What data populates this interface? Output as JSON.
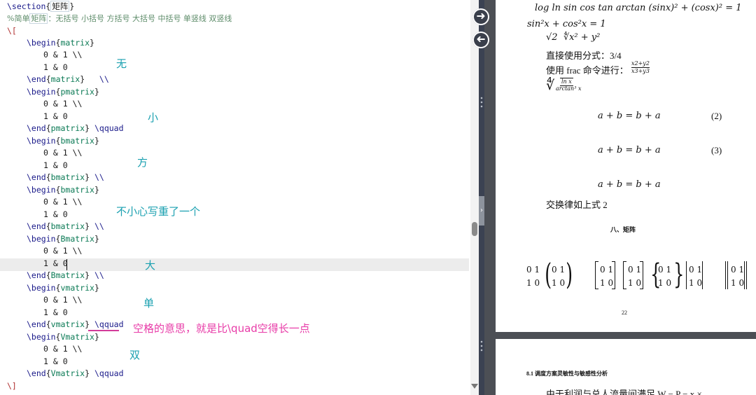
{
  "editor": {
    "lines": {
      "section": [
        "\\section",
        "{",
        "矩阵",
        "}"
      ],
      "comment": [
        "%简单",
        "矩阵",
        "：无括号 小括号 方括号 大括号 中括号 单竖线 双竖线"
      ],
      "open": "\\[",
      "close": "\\]",
      "matrix_begin": [
        "\\begin",
        "{",
        "matrix",
        "}"
      ],
      "row1": "0 & 1 \\\\",
      "row2": "1 & 0",
      "matrix_end": [
        "\\end",
        "{",
        "matrix",
        "}",
        "   \\\\"
      ],
      "pmatrix_begin": [
        "\\begin",
        "{",
        "pmatrix",
        "}"
      ],
      "pmatrix_end": [
        "\\end",
        "{",
        "pmatrix",
        "}",
        " \\qquad"
      ],
      "bmatrix_begin": [
        "\\begin",
        "{",
        "bmatrix",
        "}"
      ],
      "bmatrix_end": [
        "\\end",
        "{",
        "bmatrix",
        "}",
        " \\\\"
      ],
      "Bmatrix_begin": [
        "\\begin",
        "{",
        "Bmatrix",
        "}"
      ],
      "Bmatrix_end": [
        "\\end",
        "{",
        "Bmatrix",
        "}",
        " \\\\"
      ],
      "vmatrix_begin": [
        "\\begin",
        "{",
        "vmatrix",
        "}"
      ],
      "vmatrix_end": [
        "\\end",
        "{",
        "vmatrix",
        "}",
        " \\qquad"
      ],
      "Vmatrix_begin": [
        "\\begin",
        "{",
        "Vmatrix",
        "}"
      ],
      "Vmatrix_end": [
        "\\end",
        "{",
        "Vmatrix",
        "}",
        " \\qquad"
      ]
    },
    "annotations": {
      "none": "无",
      "small": "小",
      "square": "方",
      "duplicate": "不小心写重了一个",
      "large": "大",
      "single": "单",
      "qquad_note": "空格的意思，就是比\\quad空得长一点",
      "double": "双"
    }
  },
  "viewer": {
    "nav": {
      "forward": "➜",
      "back": "➜",
      "collapse": "›"
    },
    "page1": {
      "line_log": "log ln sin cos tan arctan (sinx)² + (cosx)² = 1",
      "line_sin": "sin²x + cos²x = 1",
      "line_sqrt": "√2  ∜x² + y²",
      "line_direct": "直接使用分式：3/4",
      "line_frac_prefix": "使用 frac 命令进行：",
      "frac_num": "x2+y2",
      "frac_den": "x3+y3",
      "line_root": "∜",
      "root_num": "ln x",
      "root_den": "arctan³ x",
      "eq_a": "a + b = b + a",
      "eq_a_num": "(2)",
      "eq_b": "a + b = b + a",
      "eq_b_num": "(3)",
      "eq_c": "a + b = b + a",
      "comm_text": "交换律如上式 2",
      "section_heading": "八、矩阵",
      "matrix_cells": "0 1\n1 0",
      "page_number": "22"
    },
    "page2": {
      "heading": "8.1 调度方案灵敏性与敏感性分析",
      "text": "由于利润与总人流量间满足 W − P − x ×"
    }
  },
  "colors": {
    "annotation": "#1aa0b0",
    "annotation_pink": "#e83ca8",
    "env_name": "#0b7a55",
    "viewer_bg": "#4c4f55",
    "divider": "#3b4252"
  }
}
